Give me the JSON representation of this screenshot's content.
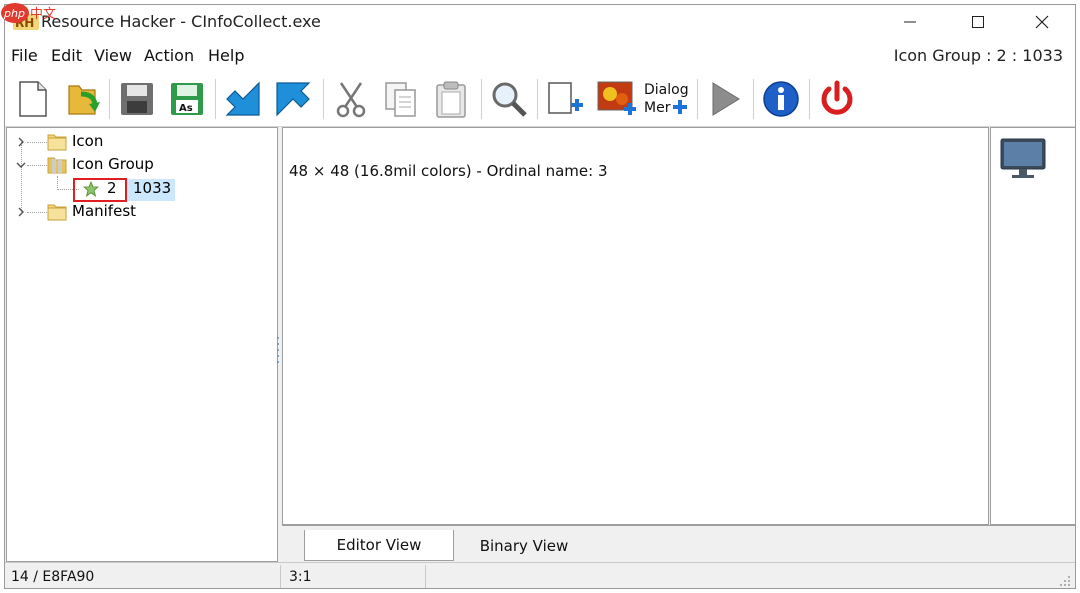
{
  "watermark": {
    "text": "php中文网"
  },
  "window": {
    "title": "Resource Hacker - CInfoCollect.exe",
    "controls": [
      "minimize",
      "maximize",
      "close"
    ]
  },
  "menu": {
    "items": [
      "File",
      "Edit",
      "View",
      "Action",
      "Help"
    ],
    "status_right": "Icon Group : 2 : 1033"
  },
  "toolbar": {
    "icons": [
      "new-file-icon",
      "open-file-icon",
      "save-icon",
      "save-as-icon",
      "compile-icon",
      "go-to-icon",
      "cut-icon",
      "copy-icon",
      "paste-icon",
      "find-icon",
      "add-blank-resource-icon",
      "add-image-resource-icon",
      "dialog-menu-icon",
      "run-script-icon",
      "info-icon",
      "exit-icon"
    ],
    "save_as_label": "As",
    "dialog_label_1": "Dialog",
    "dialog_label_2": "Mer"
  },
  "tree": {
    "items": [
      {
        "label": "Icon",
        "expanded": false
      },
      {
        "label": "Icon Group",
        "expanded": true,
        "children": [
          {
            "label": "2",
            "lang": "1033"
          }
        ]
      },
      {
        "label": "Manifest",
        "expanded": false
      }
    ]
  },
  "editor": {
    "text": "48 × 48 (16.8mil colors) - Ordinal name: 3"
  },
  "tabs": [
    {
      "label": "Editor View",
      "active": true
    },
    {
      "label": "Binary View",
      "active": false
    }
  ],
  "status": {
    "left": "14 / E8FA90",
    "middle": "3:1"
  },
  "colors": {
    "selection_highlight": "#cce8ff",
    "annotation_red": "#e02020",
    "accent_blue": "#1e73d8"
  }
}
